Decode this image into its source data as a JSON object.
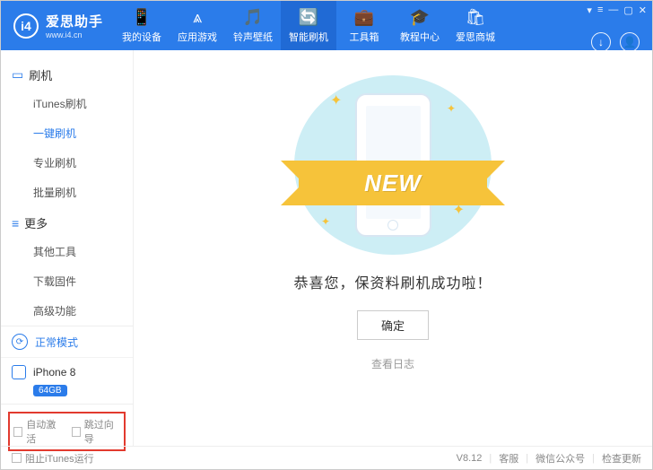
{
  "logo": {
    "badge": "i4",
    "cn": "爱思助手",
    "en": "www.i4.cn"
  },
  "nav": [
    {
      "icon": "📱",
      "label": "我的设备"
    },
    {
      "icon": "⩓",
      "label": "应用游戏"
    },
    {
      "icon": "🎵",
      "label": "铃声壁纸"
    },
    {
      "icon": "🔄",
      "label": "智能刷机",
      "active": true
    },
    {
      "icon": "💼",
      "label": "工具箱"
    },
    {
      "icon": "🎓",
      "label": "教程中心"
    },
    {
      "icon": "🛍",
      "label": "爱思商城"
    }
  ],
  "sidebar": {
    "sections": [
      {
        "title": "刷机",
        "icon": "▭",
        "items": [
          {
            "label": "iTunes刷机"
          },
          {
            "label": "一键刷机",
            "active": true
          },
          {
            "label": "专业刷机"
          },
          {
            "label": "批量刷机"
          }
        ]
      },
      {
        "title": "更多",
        "icon": "≡",
        "items": [
          {
            "label": "其他工具"
          },
          {
            "label": "下载固件"
          },
          {
            "label": "高级功能"
          }
        ]
      }
    ],
    "status": {
      "label": "正常模式"
    },
    "device": {
      "name": "iPhone 8",
      "badge": "64GB"
    },
    "checks": {
      "auto_activate": "自动激活",
      "skip_guide": "跳过向导"
    }
  },
  "main": {
    "ribbon": "NEW",
    "success": "恭喜您，保资料刷机成功啦！",
    "ok": "确定",
    "view_log": "查看日志"
  },
  "footer": {
    "block_itunes": "阻止iTunes运行",
    "version": "V8.12",
    "links": [
      "客服",
      "微信公众号",
      "检查更新"
    ]
  }
}
